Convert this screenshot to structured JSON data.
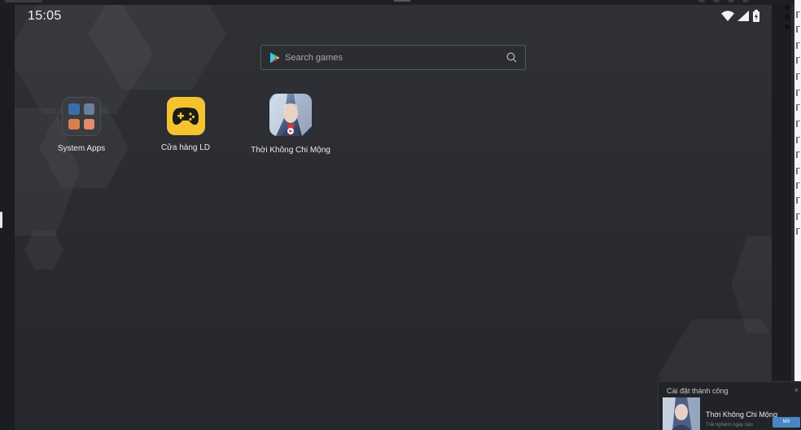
{
  "status_bar": {
    "time": "15:05",
    "icons": [
      "wifi-icon",
      "signal-icon",
      "battery-icon"
    ]
  },
  "search": {
    "placeholder": "Search games",
    "left_icon": "play-store-icon",
    "right_icon": "search-icon"
  },
  "apps": [
    {
      "label": "System Apps",
      "icon": "folder-icon"
    },
    {
      "label": "Cửa hàng LD",
      "icon": "gamepad-icon"
    },
    {
      "label": "Thời Không Chi Mộng",
      "icon": "game-art-icon"
    }
  ],
  "toast": {
    "title": "Cài đặt thành công",
    "app_name": "Thời Không Chi Mộng",
    "subtitle": "Trải nghiệm ngay nào",
    "button": "Mở",
    "close": "×"
  },
  "colors": {
    "accent_yellow": "#f4c32e",
    "button_blue": "#4a86c5",
    "background": "#2a2c31"
  }
}
